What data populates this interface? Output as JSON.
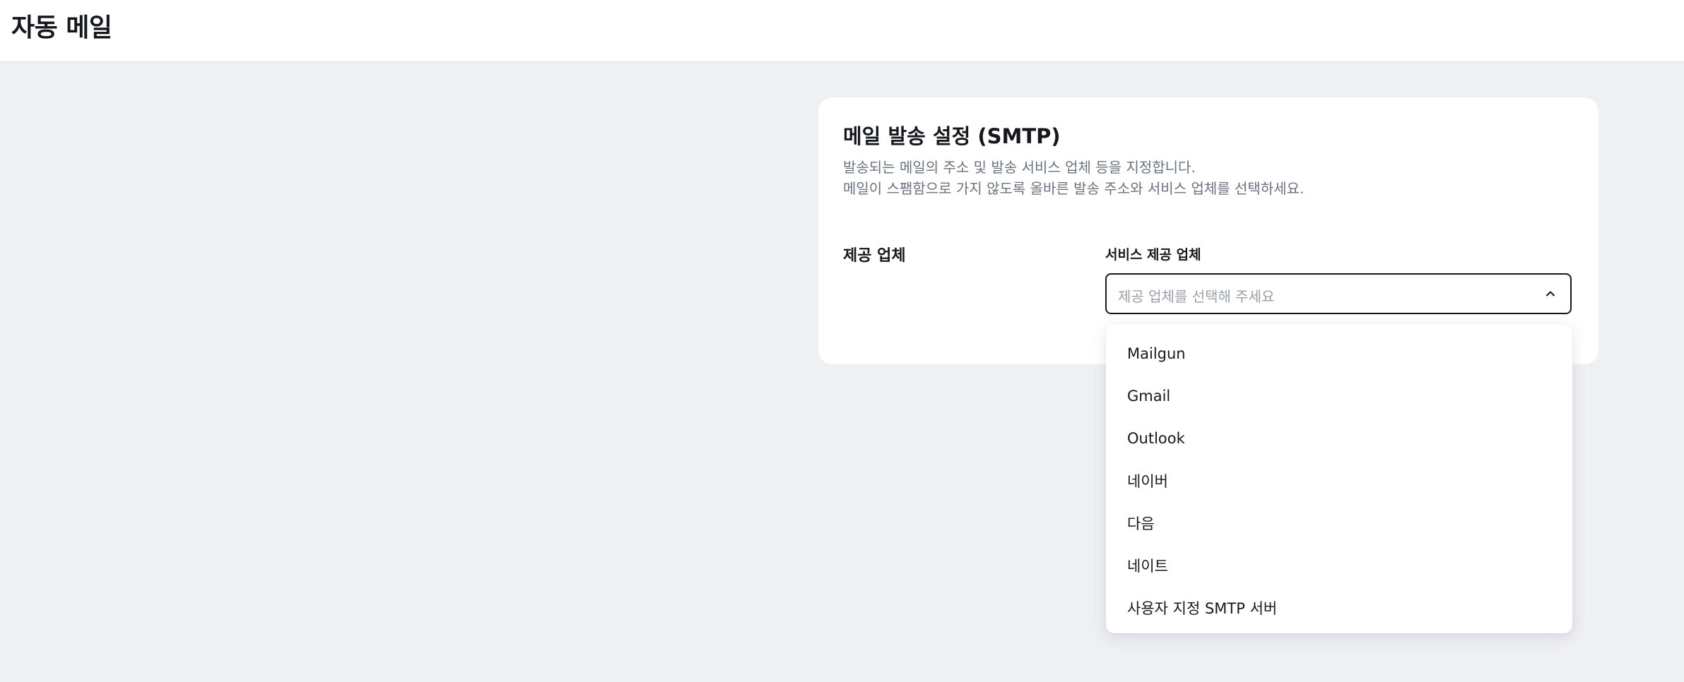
{
  "header": {
    "title": "자동 메일"
  },
  "card": {
    "title": "메일 발송 설정 (SMTP)",
    "description_lines": [
      "발송되는 메일의 주소 및 발송 서비스 업체 등을 지정합니다.",
      "메일이 스팸함으로 가지 않도록 올바른 발송 주소와 서비스 업체를 선택하세요."
    ],
    "row_label": "제공 업체",
    "field_label": "서비스 제공 업체",
    "select": {
      "placeholder": "제공 업체를 선택해 주세요",
      "icon": "chevron-up-icon",
      "expanded": true
    }
  },
  "dropdown": {
    "options": [
      "Mailgun",
      "Gmail",
      "Outlook",
      "네이버",
      "다음",
      "네이트",
      "사용자 지정 SMTP 서버"
    ]
  },
  "colors": {
    "page_background": "#eef0f4",
    "surface": "#ffffff",
    "text_primary": "#16181d",
    "text_secondary": "#6b7280",
    "placeholder": "#9aa0aa"
  }
}
